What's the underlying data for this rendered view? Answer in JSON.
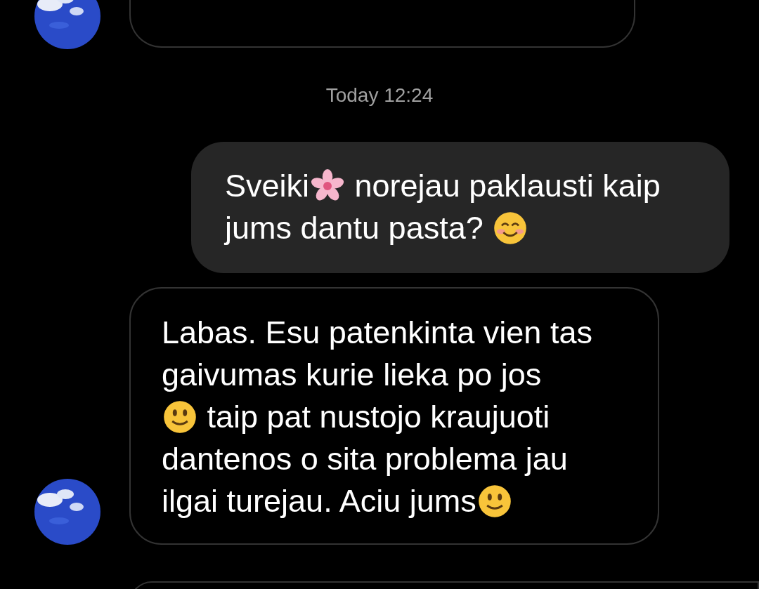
{
  "messages": [
    {
      "kind": "cut-top",
      "avatar": true
    },
    {
      "kind": "timestamp",
      "text": "Today 12:24"
    },
    {
      "kind": "sent",
      "lines": [
        [
          {
            "kind": "text",
            "text": "Sveiki"
          },
          {
            "kind": "blossom"
          },
          {
            "kind": "text",
            "text": " norejau paklausti kaip"
          }
        ],
        [
          {
            "kind": "text",
            "text": "jums dantu pasta? "
          },
          {
            "kind": "smile"
          }
        ]
      ]
    },
    {
      "kind": "received",
      "avatar": true,
      "lines": [
        [
          {
            "kind": "text",
            "text": "Labas. Esu patenkinta vien tas"
          }
        ],
        [
          {
            "kind": "text",
            "text": "gaivumas kurie lieka po jos"
          }
        ],
        [
          {
            "kind": "slight-smile"
          },
          {
            "kind": "text",
            "text": " taip pat nustojo kraujuoti"
          }
        ],
        [
          {
            "kind": "text",
            "text": "dantenos o sita problema jau"
          }
        ],
        [
          {
            "kind": "text",
            "text": "ilgai turejau. Aciu jums"
          },
          {
            "kind": "slight-smile"
          }
        ]
      ]
    },
    {
      "kind": "cut-bottom"
    }
  ]
}
